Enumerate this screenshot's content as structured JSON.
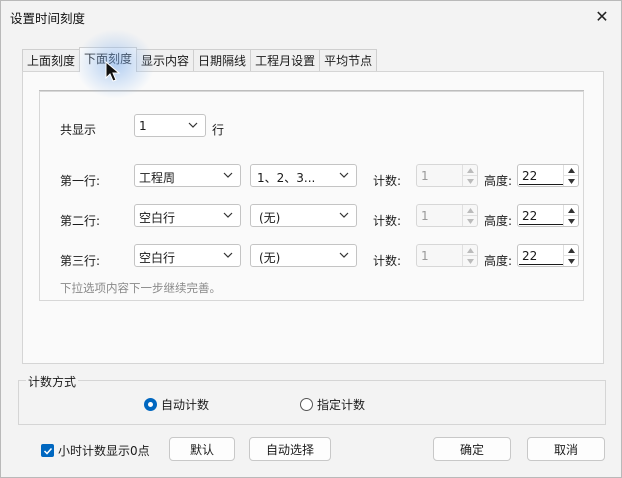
{
  "window": {
    "title": "设置时间刻度",
    "close_glyph": "✕"
  },
  "tabs": [
    {
      "label": "上面刻度"
    },
    {
      "label": "下面刻度",
      "active": true
    },
    {
      "label": "显示内容"
    },
    {
      "label": "日期隔线"
    },
    {
      "label": "工程月设置"
    },
    {
      "label": "平均节点"
    }
  ],
  "display": {
    "label": "共显示",
    "rows_value": "1",
    "suffix": "行"
  },
  "rows": [
    {
      "label": "第一行:",
      "unit": "工程周",
      "format": "1、2、3...",
      "count_label": "计数:",
      "count": "1",
      "height_label": "高度:",
      "height": "22"
    },
    {
      "label": "第二行:",
      "unit": "空白行",
      "format": "(无)",
      "count_label": "计数:",
      "count": "1",
      "height_label": "高度:",
      "height": "22"
    },
    {
      "label": "第三行:",
      "unit": "空白行",
      "format": "(无)",
      "count_label": "计数:",
      "count": "1",
      "height_label": "高度:",
      "height": "22"
    }
  ],
  "note": "下拉选项内容下一步继续完善。",
  "count_mode": {
    "title": "计数方式",
    "options": [
      {
        "label": "自动计数",
        "selected": true
      },
      {
        "label": "指定计数",
        "selected": false
      }
    ]
  },
  "footer": {
    "checkbox_label": "小时计数显示0点",
    "checkbox_checked": true,
    "default_button": "默认",
    "auto_select_button": "自动选择",
    "ok_button": "确定",
    "cancel_button": "取消"
  },
  "colors": {
    "accent": "#0067c0",
    "hover_glow": "#7aaaeb"
  }
}
